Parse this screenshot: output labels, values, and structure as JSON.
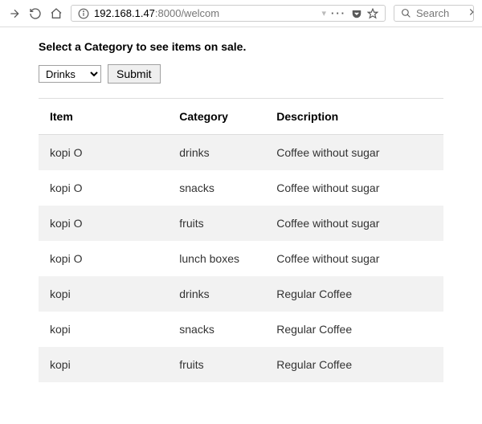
{
  "toolbar": {
    "url_ip": "192.168.1.47",
    "url_rest": ":8000/welcom",
    "search_placeholder": "Search"
  },
  "page": {
    "heading": "Select a Category to see items on sale.",
    "category_selected": "Drinks",
    "submit_label": "Submit"
  },
  "table": {
    "headers": {
      "item": "Item",
      "category": "Category",
      "description": "Description"
    },
    "rows": [
      {
        "item": "kopi O",
        "category": "drinks",
        "description": "Coffee without sugar"
      },
      {
        "item": "kopi O",
        "category": "snacks",
        "description": "Coffee without sugar"
      },
      {
        "item": "kopi O",
        "category": "fruits",
        "description": "Coffee without sugar"
      },
      {
        "item": "kopi O",
        "category": "lunch boxes",
        "description": "Coffee without sugar"
      },
      {
        "item": "kopi",
        "category": "drinks",
        "description": "Regular Coffee"
      },
      {
        "item": "kopi",
        "category": "snacks",
        "description": "Regular Coffee"
      },
      {
        "item": "kopi",
        "category": "fruits",
        "description": "Regular Coffee"
      }
    ]
  }
}
